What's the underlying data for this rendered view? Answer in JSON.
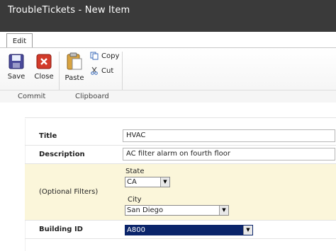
{
  "window": {
    "title": "TroubleTickets - New Item"
  },
  "ribbon": {
    "tab_label": "Edit",
    "buttons": {
      "save": "Save",
      "close": "Close",
      "paste": "Paste",
      "copy": "Copy",
      "cut": "Cut"
    },
    "groups": {
      "commit": "Commit",
      "clipboard": "Clipboard"
    }
  },
  "form": {
    "title": {
      "label": "Title",
      "value": "HVAC"
    },
    "description": {
      "label": "Description",
      "value": "AC filter alarm on fourth floor"
    },
    "filters": {
      "label": "(Optional Filters)",
      "state": {
        "label": "State",
        "value": "CA"
      },
      "city": {
        "label": "City",
        "value": "San Diego"
      }
    },
    "building": {
      "label": "Building ID",
      "value": "A800"
    }
  },
  "colors": {
    "titlebar": "#3a3a3a",
    "filter_bg": "#fbf6da",
    "selection": "#0a246a"
  }
}
